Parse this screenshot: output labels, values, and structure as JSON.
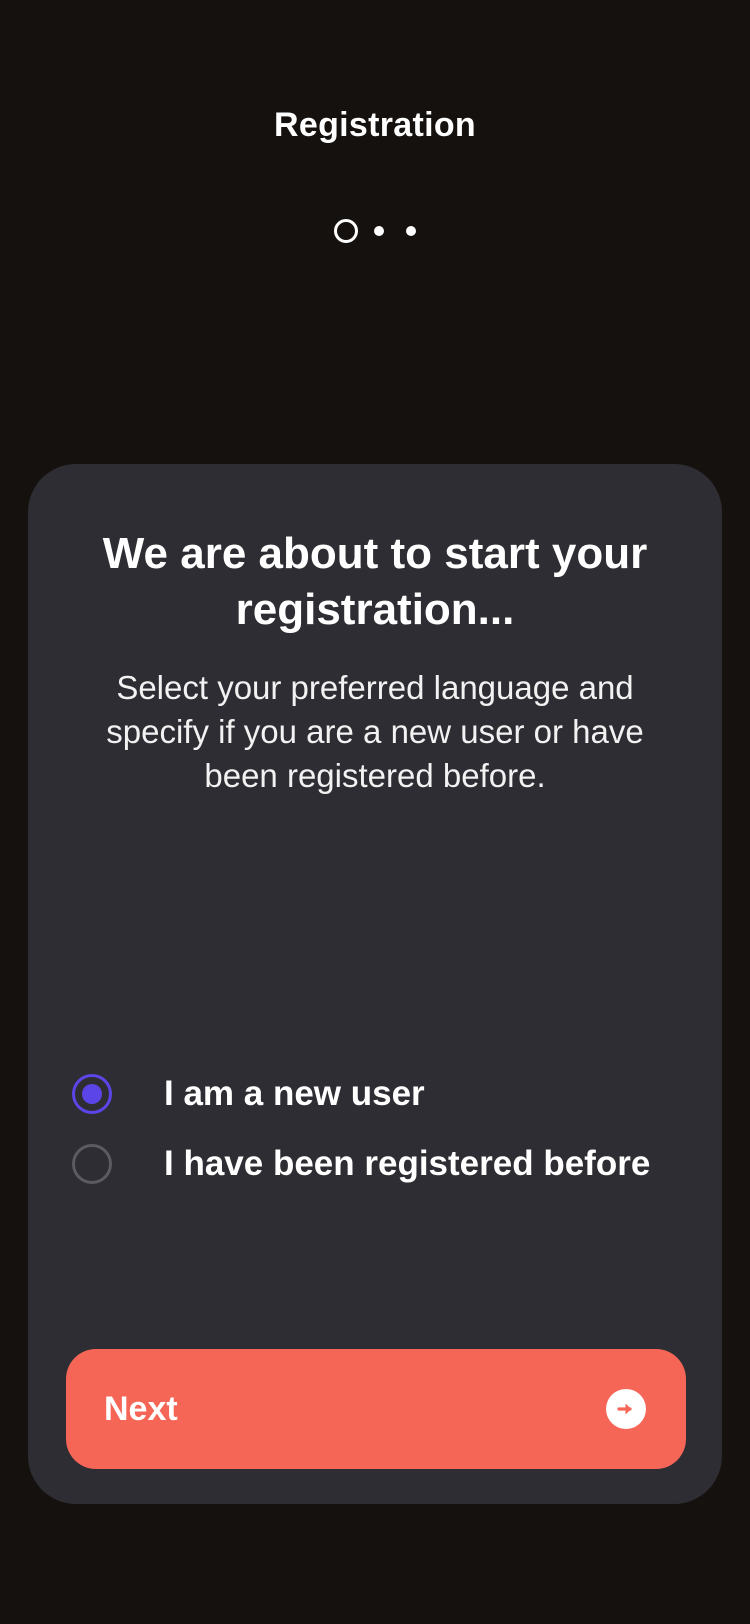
{
  "header": {
    "title": "Registration"
  },
  "steps": {
    "total": 3,
    "current": 1
  },
  "card": {
    "title": "We are about to start your registration...",
    "subtitle": "Select your preferred language and specify if you are a new user or have been registered before."
  },
  "options": [
    {
      "label": "I am a new user",
      "selected": true
    },
    {
      "label": "I have been registered before",
      "selected": false
    }
  ],
  "next_button": {
    "label": "Next",
    "icon": "arrow-right-circle-icon"
  },
  "colors": {
    "background": "#15110e",
    "card": "#2e2d33",
    "accent": "#5b45e8",
    "button": "#f56657"
  }
}
